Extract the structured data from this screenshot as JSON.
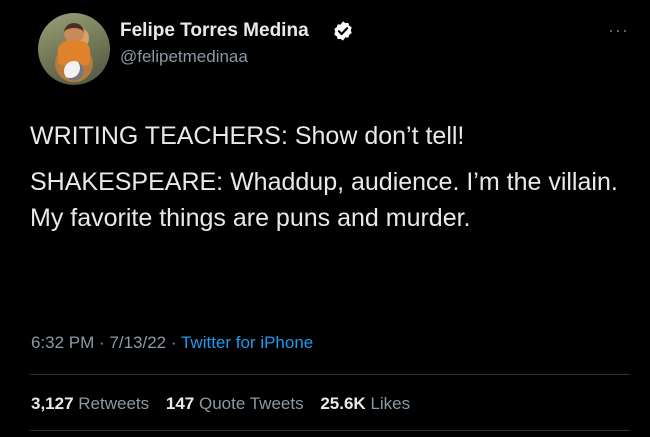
{
  "author": {
    "name": "Felipe Torres Medina",
    "handle": "@felipetmedinaa"
  },
  "more_icon": "···",
  "tweet": {
    "line1": "WRITING TEACHERS: Show don’t tell!",
    "line2": "SHAKESPEARE: Whaddup, audience. I’m the villain. My favorite things are puns and murder."
  },
  "meta": {
    "time": "6:32 PM",
    "sep1": " · ",
    "date": "7/13/22",
    "sep2": " · ",
    "source": "Twitter for iPhone"
  },
  "stats": {
    "retweets_count": "3,127",
    "retweets_label": "Retweets",
    "quotes_count": "147",
    "quotes_label": "Quote Tweets",
    "likes_count": "25.6K",
    "likes_label": "Likes"
  },
  "colors": {
    "background": "#000000",
    "text": "#e7e9ea",
    "secondary": "#8b98a5",
    "link": "#1d9bf0",
    "verified_badge": "#ffffff"
  }
}
